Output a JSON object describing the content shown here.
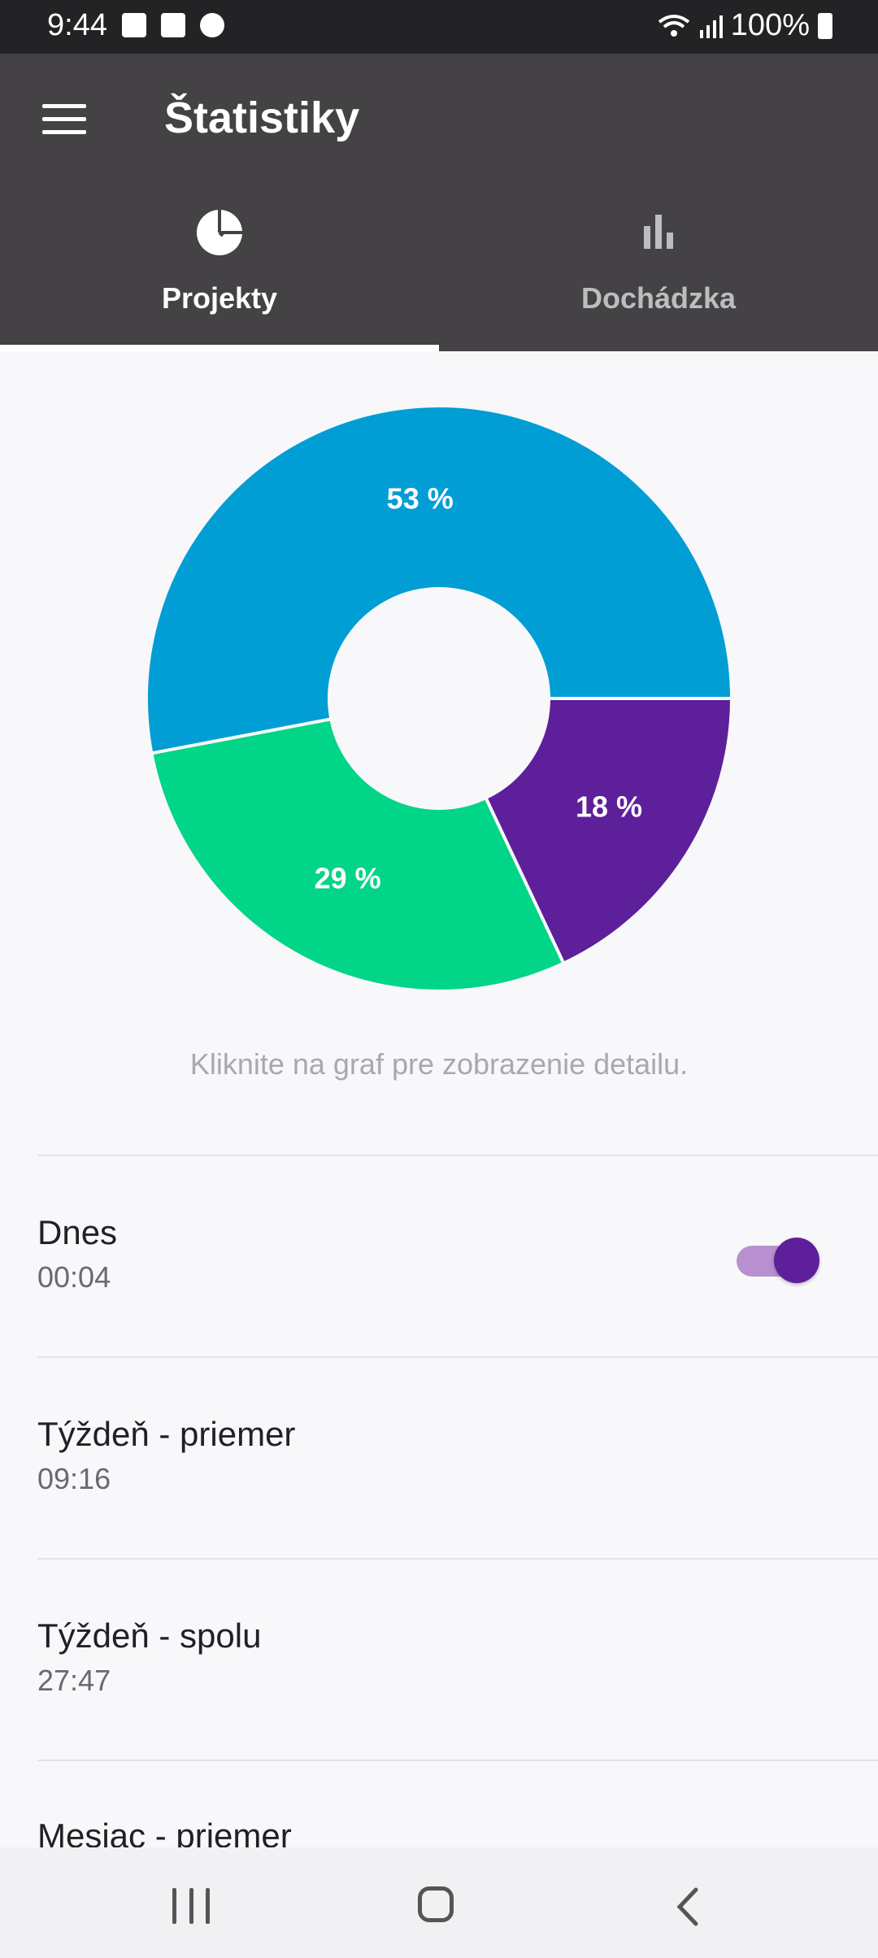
{
  "status_bar": {
    "time": "9:44",
    "battery": "100%"
  },
  "app_bar": {
    "title": "Štatistiky"
  },
  "tabs": [
    {
      "label": "Projekty",
      "icon": "pie-chart-icon",
      "selected": true
    },
    {
      "label": "Dochádzka",
      "icon": "bar-chart-icon",
      "selected": false
    }
  ],
  "chart_data": {
    "type": "pie",
    "categories": [
      "",
      "",
      ""
    ],
    "values": [
      53,
      18,
      29
    ],
    "labels": [
      "53 %",
      "18 %",
      "29 %"
    ],
    "colors": [
      "#009ed5",
      "#5e1f9a",
      "#00d588"
    ]
  },
  "hint": "Kliknite na graf pre zobrazenie detailu.",
  "stats": [
    {
      "label": "Dnes",
      "value": "00:04",
      "toggle": true
    },
    {
      "label": "Týždeň - priemer",
      "value": "09:16"
    },
    {
      "label": "Týždeň - spolu",
      "value": "27:47"
    },
    {
      "label": "Mesiac - priemer",
      "value": ""
    }
  ]
}
